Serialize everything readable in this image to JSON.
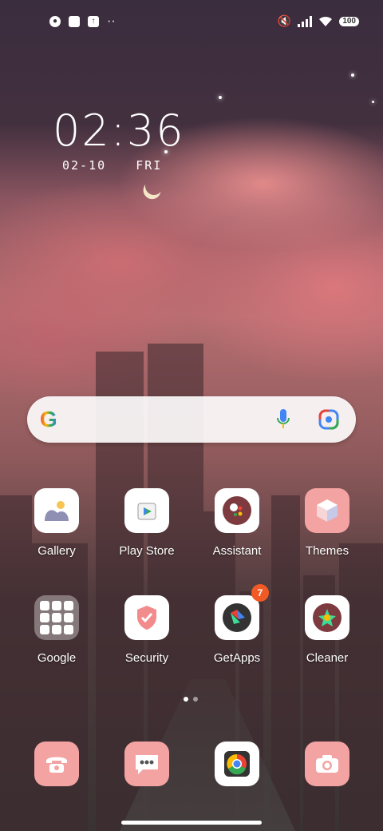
{
  "status_bar": {
    "left_icons": [
      "notification-icon",
      "square-icon",
      "upload-icon"
    ],
    "more_dots": "··",
    "right_icons": [
      "mute-icon",
      "signal-icon",
      "wifi-icon"
    ],
    "battery": "100"
  },
  "clock": {
    "time": "02:36",
    "date": "02-10",
    "day": "FRI"
  },
  "search_bar": {
    "logo": "G"
  },
  "apps": [
    {
      "label": "Gallery",
      "icon": "gallery-icon"
    },
    {
      "label": "Play Store",
      "icon": "play-store-icon"
    },
    {
      "label": "Assistant",
      "icon": "assistant-icon"
    },
    {
      "label": "Themes",
      "icon": "themes-icon"
    },
    {
      "label": "Google",
      "icon": "folder-icon"
    },
    {
      "label": "Security",
      "icon": "security-icon"
    },
    {
      "label": "GetApps",
      "icon": "getapps-icon",
      "badge": "7"
    },
    {
      "label": "Cleaner",
      "icon": "cleaner-icon"
    }
  ],
  "dock": [
    {
      "icon": "phone-icon"
    },
    {
      "icon": "messages-icon"
    },
    {
      "icon": "chrome-icon"
    },
    {
      "icon": "camera-icon"
    }
  ],
  "colors": {
    "accent_pink": "#f4a3a3",
    "badge": "#f15a24"
  }
}
